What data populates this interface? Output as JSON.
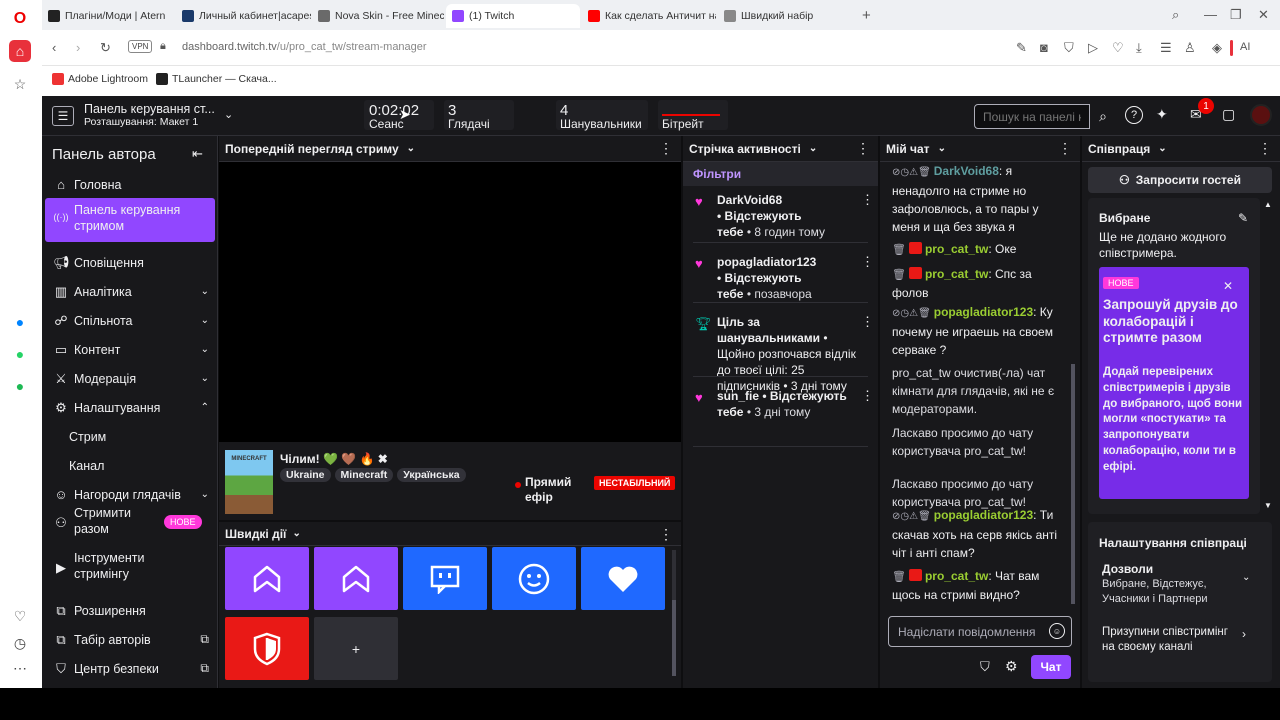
{
  "browser": {
    "tabs": [
      {
        "label": "Плагіни/Моди | Atern",
        "active": false,
        "fav": "#222"
      },
      {
        "label": "Личный кабинет|acapes",
        "active": false,
        "fav": "#1a3a6a"
      },
      {
        "label": "Nova Skin - Free Minecraft",
        "active": false,
        "fav": "#6a6a6a"
      },
      {
        "label": "(1) Twitch",
        "active": true,
        "fav": "#9146ff"
      },
      {
        "label": "Как сделать Античит на А",
        "active": false,
        "fav": "#ff0000"
      },
      {
        "label": "Швидкий набір",
        "active": false,
        "fav": "#888"
      }
    ],
    "url_domain": "dashboard.twitch.tv",
    "url_path": "/u/pro_cat_tw/stream-manager",
    "vpn": "VPN",
    "ai": "AI",
    "bookmarks": [
      {
        "label": "Adobe Lightroom",
        "fav": "#e33"
      },
      {
        "label": "TLauncher — Скача...",
        "fav": "#222"
      }
    ]
  },
  "topbar": {
    "title": "Панель керування ст...",
    "subtitle": "Розташування: Макет 1",
    "session_time": "0:02:02",
    "session_label": "Сеанс",
    "viewers": "3",
    "viewers_label": "Глядачі",
    "followers": "4",
    "followers_label": "Шанувальники",
    "bitrate_label": "Бітрейт",
    "search_placeholder": "Пошук на панелі к",
    "inbox_badge": "1"
  },
  "leftnav": {
    "title": "Панель автора",
    "items": [
      {
        "label": "Головна",
        "icon": "home-icon"
      },
      {
        "label": "Панель керування стримом",
        "icon": "broadcast-icon",
        "active": true
      },
      {
        "label": "Сповіщення",
        "icon": "megaphone-icon"
      },
      {
        "label": "Аналітика",
        "icon": "chart-icon"
      },
      {
        "label": "Спільнота",
        "icon": "community-icon"
      },
      {
        "label": "Контент",
        "icon": "content-icon"
      },
      {
        "label": "Модерація",
        "icon": "sword-icon"
      },
      {
        "label": "Налаштування",
        "icon": "gear-icon"
      },
      {
        "label": "Стрим"
      },
      {
        "label": "Канал"
      },
      {
        "label": "Нагороди глядачів",
        "icon": "reward-icon"
      },
      {
        "label": "Стримити разом",
        "icon": "add-person-icon"
      },
      {
        "label": "Інструменти стримінгу",
        "icon": "camera-icon"
      },
      {
        "label": "Розширення",
        "icon": "puzzle-icon"
      },
      {
        "label": "Табір авторів",
        "icon": "book-icon"
      },
      {
        "label": "Центр безпеки",
        "icon": "shield-icon"
      }
    ],
    "new_badge": "НОВЕ"
  },
  "preview": {
    "header": "Попередній перегляд стриму",
    "title": "Чілим! 💚 🤎 🔥 ✖",
    "tags": [
      "Ukraine",
      "Minecraft",
      "Українська"
    ],
    "live_label": "Прямий ефір",
    "status_badge": "НЕСТАБІЛЬНИЙ",
    "thumb_text": "MINECRAFT"
  },
  "quick_actions": {
    "header": "Швидкі дії",
    "add_label": "+"
  },
  "activity": {
    "header": "Стрічка активності",
    "filters": "Фільтри",
    "items": [
      {
        "name": "DarkVoid68",
        "line2": "• Відстежують",
        "line3a": "тебе",
        "line3b": " • 8 годин тому"
      },
      {
        "name": "popagladiator123",
        "line2": "• Відстежують",
        "line3a": "тебе",
        "line3b": " • позавчора"
      },
      {
        "name": "Ціль за",
        "name2": "шанувальниками",
        "text": " • Щойно розпочався відлік до твоєї цілі: 25 підписників • 3 дні тому"
      },
      {
        "name": "sun_fie",
        "line2": " • Відстежують",
        "line3a": "тебе",
        "line3b": " • 3 дні тому"
      }
    ]
  },
  "chat": {
    "header": "Мій чат",
    "messages": [
      {
        "user": "DarkVoid68",
        "text": ": я ненадолго на стриме но зафоловлюсь, а то пары у меня и ща без звука я"
      },
      {
        "user": "pro_cat_tw",
        "text": ": Оке"
      },
      {
        "user": "pro_cat_tw",
        "text": ": Спс за фолов"
      },
      {
        "user": "popagladiator123",
        "text": ": Ку почему не играешь на своем серваке ?"
      },
      {
        "system": "pro_cat_tw очистив(-ла) чат кімнати для глядачів, які не є модераторами."
      },
      {
        "system": "Ласкаво просимо до чату користувача pro_cat_tw!"
      },
      {
        "system": "Ласкаво просимо до чату користувача pro_cat_tw!"
      },
      {
        "user": "popagladiator123",
        "text": ": Ти скачав хоть на серв якісь анті чіт і анті спам?"
      },
      {
        "user": "pro_cat_tw",
        "text": ": Чат вам щось на стримі видно?"
      }
    ],
    "input_placeholder": "Надіслати повідомлення",
    "send_label": "Чат",
    "user_colors": {
      "DarkVoid68": "#5f9ea0",
      "pro_cat_tw": "#9acd32",
      "popagladiator123": "#9acd32"
    }
  },
  "collab": {
    "header": "Співпраця",
    "invite_label": "Запросити гостей",
    "favorites_title": "Вибране",
    "favorites_empty": "Ще не додано жодного співстримера.",
    "promo_badge": "НОВЕ",
    "promo_title": "Запрошуй друзів до колаборацій і стримте разом",
    "promo_text": "Додай перевірених співстримерів і друзів до вибраного, щоб вони могли «постукати» та запропонувати колаборацію, коли ти в ефірі.",
    "settings_title": "Налаштування співпраці",
    "perm_title": "Дозволи",
    "perm_value": "Вибране, Відстежує, Учасники і Партнери",
    "pause_label": "Призупини співстримінг на своєму каналі"
  },
  "colors": {
    "accent": "#9147ff",
    "live_red": "#eb0400",
    "qa_purple": "#9147ff",
    "qa_blue": "#1f69ff",
    "qa_red": "#e91916",
    "love": "#ff38db"
  }
}
